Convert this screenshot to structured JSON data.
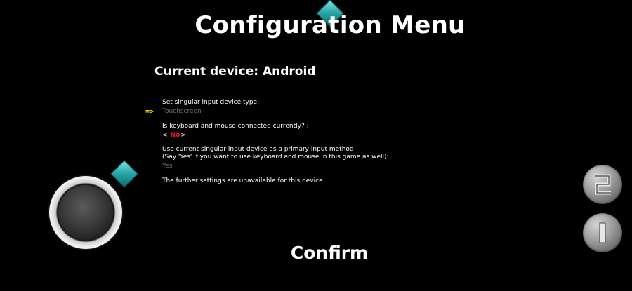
{
  "title": "Configuration Menu",
  "device_line": "Current device: Android",
  "settings": {
    "input_type_label": "Set singular input device type:",
    "input_type_value": "Touchscreen",
    "selector_arrow": "=>",
    "keyboard_question": "Is keyboard and mouse connected currently? :",
    "keyboard_left": "<",
    "keyboard_value": "No",
    "keyboard_right": ">",
    "primary_label_1": "Use current singular input device as a primary input method",
    "primary_label_2": "(Say 'Yes' if you want to use keyboard and mouse in this game as well):",
    "primary_value": "Yes",
    "unavailable_note": "The further settings are unavailable for this device."
  },
  "confirm_label": "Confirm",
  "controls": {
    "joystick_icon": "virtual-joystick",
    "button_2_icon": "numeral-2",
    "button_1_icon": "numeral-1"
  },
  "colors": {
    "background": "#000000",
    "selector": "#f2d600",
    "selected_value": "#e01b1b",
    "dim_value": "#6e6e6e",
    "diamond": "#2aa9a9"
  }
}
